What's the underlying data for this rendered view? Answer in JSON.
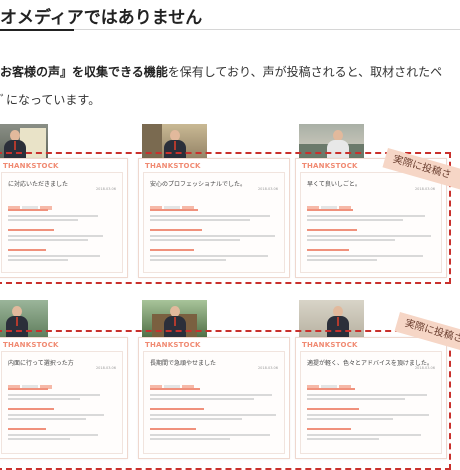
{
  "heading": "オメディアではありません",
  "lead": {
    "line1_bold": "お客様の声』を収集できる機能",
    "line1_rest": "を保有しており、声が投稿されると、取材されたペ",
    "line2": "ﾞになっています。"
  },
  "annotation_label": "実際に投稿さ",
  "brand": "THANKSTOCK",
  "cards": [
    {
      "title": "に対応いただきました",
      "date": "2018.03.06"
    },
    {
      "title": "安心のプロフェッショナルでした。",
      "date": "2018.03.06"
    },
    {
      "title": "早くて良いしごと。",
      "date": "2018.03.06"
    },
    {
      "title": "内面に行って選択った方",
      "date": "2018.03.06"
    },
    {
      "title": "長期間で急頑やせました",
      "date": "2018.03.06"
    },
    {
      "title": "適提が軽く、色々とアドバイスを頂けました。",
      "date": "2018.03.06"
    }
  ],
  "colors": {
    "accent": "#f08a72",
    "dash": "#c9302c",
    "ribbon": "#f6d6c6"
  }
}
